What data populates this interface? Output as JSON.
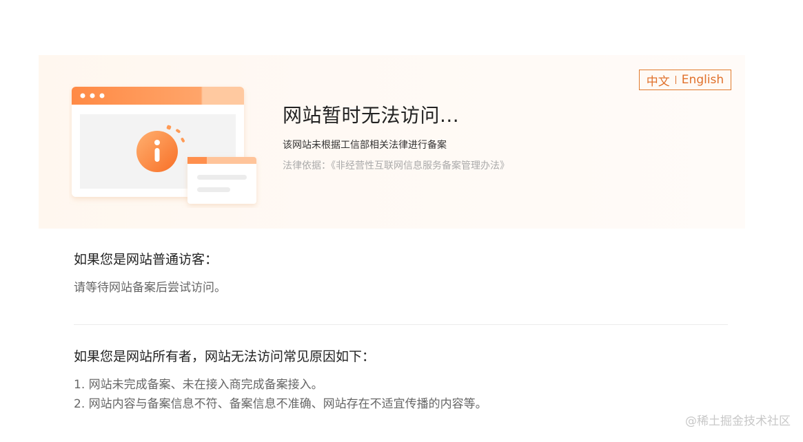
{
  "lang_switch": {
    "zh": "中文",
    "en": "English"
  },
  "notice": {
    "title": "网站暂时无法访问...",
    "subtitle": "该网站未根据工信部相关法律进行备案",
    "law": "法律依据：《非经营性互联网信息服务备案管理办法》"
  },
  "visitor": {
    "heading": "如果您是网站普通访客：",
    "text": "请等待网站备案后尝试访问。"
  },
  "owner": {
    "heading": "如果您是网站所有者，网站无法访问常见原因如下：",
    "reasons": [
      "1. 网站未完成备案、未在接入商完成备案接入。",
      "2. 网站内容与备案信息不符、备案信息不准确、网站存在不适宜传播的内容等。"
    ]
  },
  "watermark": "@稀土掘金技术社区",
  "colors": {
    "accent": "#ff8c42",
    "accent_dark": "#e0702a",
    "banner_bg": "#fff7ef"
  },
  "icons": [
    "info-icon",
    "browser-window-illustration"
  ]
}
